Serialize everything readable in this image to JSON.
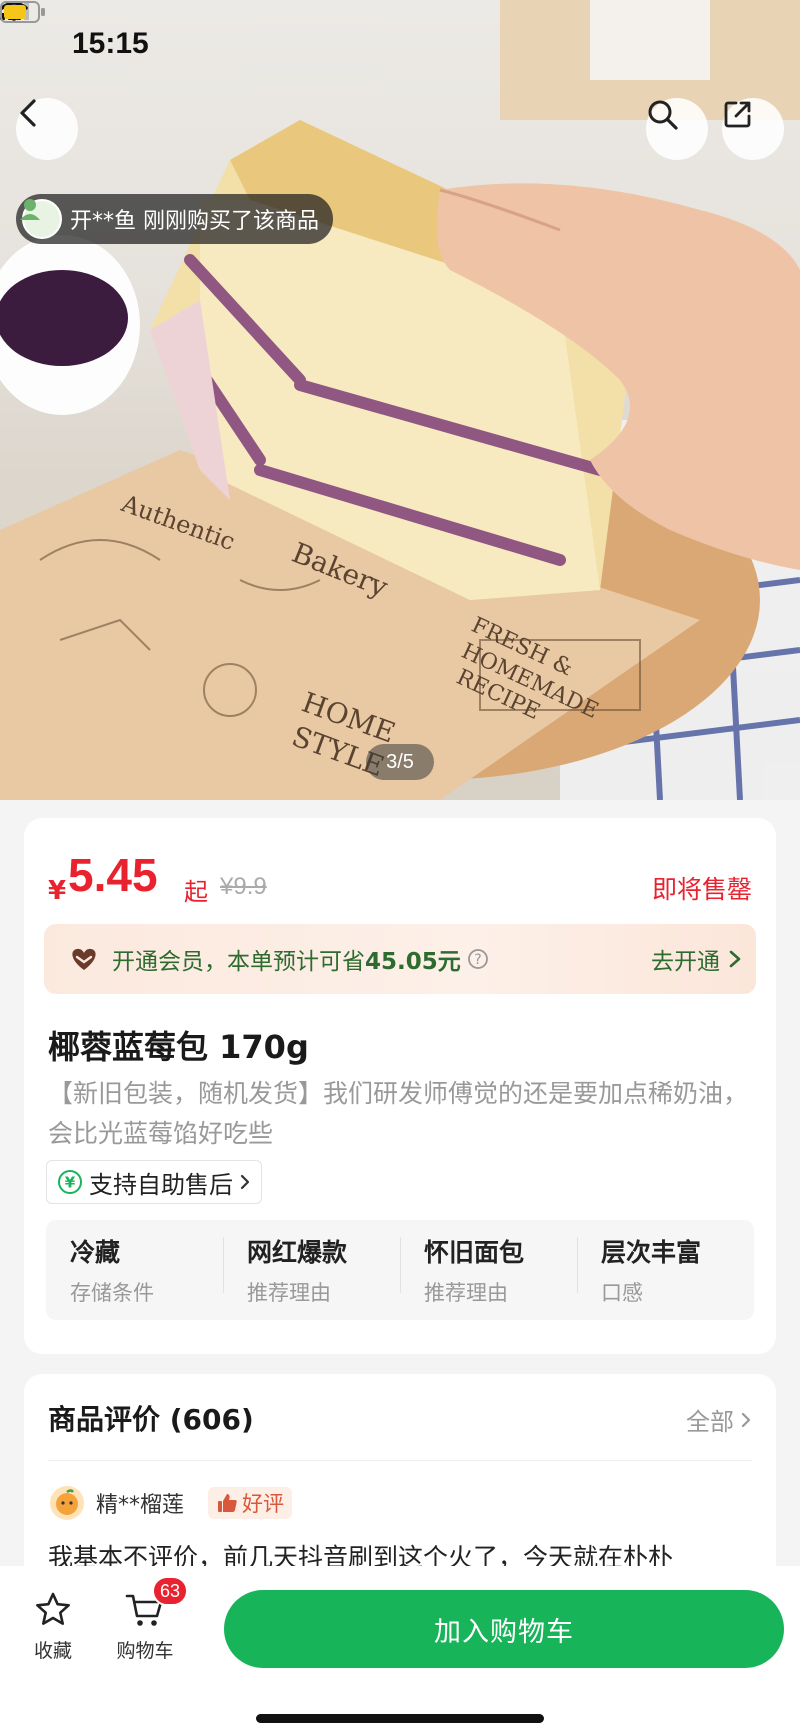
{
  "status_bar": {
    "time": "15:15"
  },
  "hero": {
    "purchase_toast": "开**鱼 刚刚购买了该商品",
    "image_counter": "3/5",
    "image_index": 3,
    "image_total": 5,
    "paper_texts": [
      "Authentic",
      "Bakery",
      "FRESH &",
      "HOMEMADE",
      "RECIPE",
      "HOME",
      "STYLE"
    ]
  },
  "price": {
    "currency": "¥",
    "value": "5.45",
    "suffix": "起",
    "original": "¥9.9",
    "status": "即将售罄"
  },
  "member": {
    "text_prefix": "开通会员，本单预计可省",
    "amount": "45.05元",
    "cta": "去开通"
  },
  "product": {
    "title": "椰蓉蓝莓包 170g",
    "description": "【新旧包装，随机发货】我们研发师傅觉的还是要加点稀奶油，会比光蓝莓馅好吃些",
    "after_sale": "支持自助售后"
  },
  "attributes": [
    {
      "value": "冷藏",
      "label": "存储条件"
    },
    {
      "value": "网红爆款",
      "label": "推荐理由"
    },
    {
      "value": "怀旧面包",
      "label": "推荐理由"
    },
    {
      "value": "层次丰富",
      "label": "口感"
    }
  ],
  "reviews": {
    "title": "商品评价 (606)",
    "all_label": "全部",
    "reviewer": "精**榴莲",
    "badge": "好评",
    "text": "我基本不评价，前几天抖音刷到这个火了，今天就在朴朴"
  },
  "bottom_bar": {
    "favorite_label": "收藏",
    "cart_label": "购物车",
    "cart_count": "63",
    "add_to_cart": "加入购物车"
  },
  "colors": {
    "accent_green": "#17b45a",
    "price_red": "#e8232f",
    "member_green": "#2d6b2f"
  }
}
